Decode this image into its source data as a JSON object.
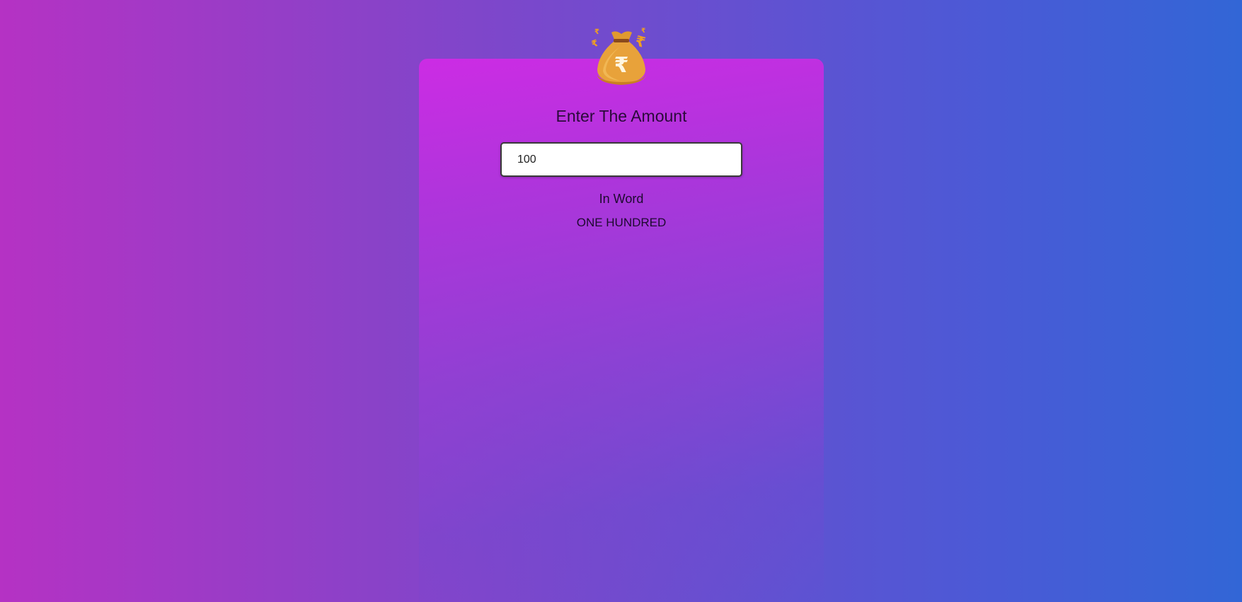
{
  "logo": {
    "icon": "money-bag-rupee-icon",
    "glyph": "₹",
    "colors": {
      "bag": "#e8a23a",
      "bag_dark": "#c97f22",
      "tie": "#8a4a1c",
      "symbol": "#fff6e0",
      "small_symbols": "#f0a020"
    }
  },
  "converter": {
    "heading": "Enter The Amount",
    "amount_value": "100",
    "in_word_label": "In Word",
    "in_word_value": "ONE HUNDRED"
  },
  "theme": {
    "bg_left": "#b532c4",
    "bg_right": "#3266d6",
    "card_top": "#cc2ce4"
  }
}
